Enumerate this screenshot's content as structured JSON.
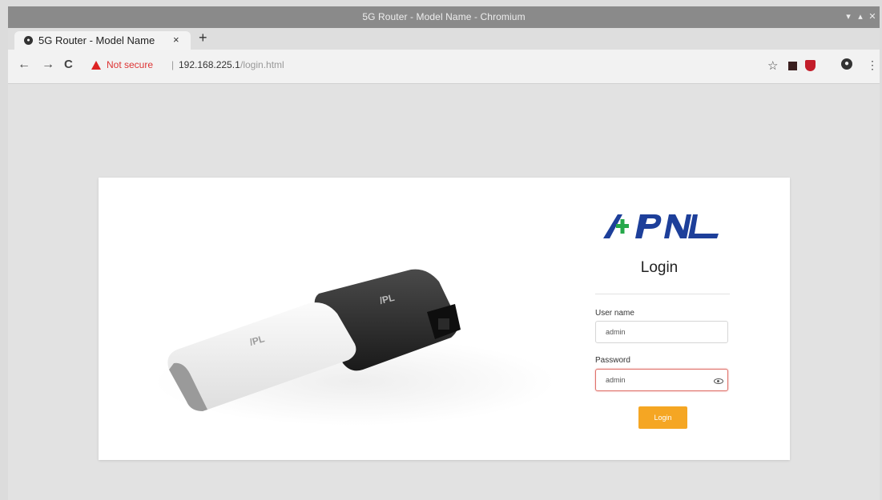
{
  "window": {
    "title": "5G Router - Model Name - Chromium",
    "controls": [
      "▾",
      "▴",
      "✕"
    ]
  },
  "tab": {
    "label": "5G Router - Model Name",
    "close": "×",
    "new_tab": "+"
  },
  "toolbar": {
    "back": "←",
    "forward": "→",
    "reload": "C",
    "security_label": "Not secure",
    "separator": "|",
    "url_host": "192.168.225.1",
    "url_path": "/login.html",
    "bookmark": "☆",
    "menu": "⋮"
  },
  "login": {
    "title": "Login",
    "username_label": "User name",
    "username_value": "admin",
    "password_label": "Password",
    "password_value": "admin",
    "submit_label": "Login"
  },
  "colors": {
    "brand_blue": "#1d3f9a",
    "brand_green": "#25a84a",
    "login_button": "#f5a623"
  }
}
